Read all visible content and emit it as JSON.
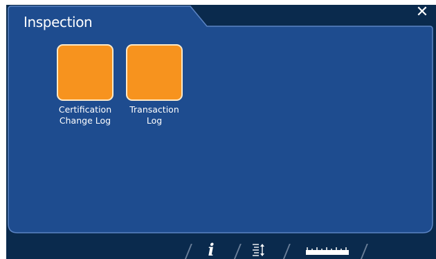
{
  "panel": {
    "title": "Inspection",
    "close_glyph": "✕"
  },
  "tiles": [
    {
      "label": "Certification\nChange Log",
      "color": "#f7931e"
    },
    {
      "label": "Transaction\nLog",
      "color": "#f7931e"
    }
  ],
  "toolbar": {
    "items": [
      {
        "icon": "info-icon",
        "glyph": "i"
      },
      {
        "icon": "sort-lines-icon"
      },
      {
        "icon": "ruler-icon"
      }
    ]
  },
  "colors": {
    "background": "#0a2a4d",
    "panel": "#1e4c8f",
    "panel_border": "#5b84c4",
    "tile": "#f7931e",
    "tile_border": "#ffe9c7"
  }
}
